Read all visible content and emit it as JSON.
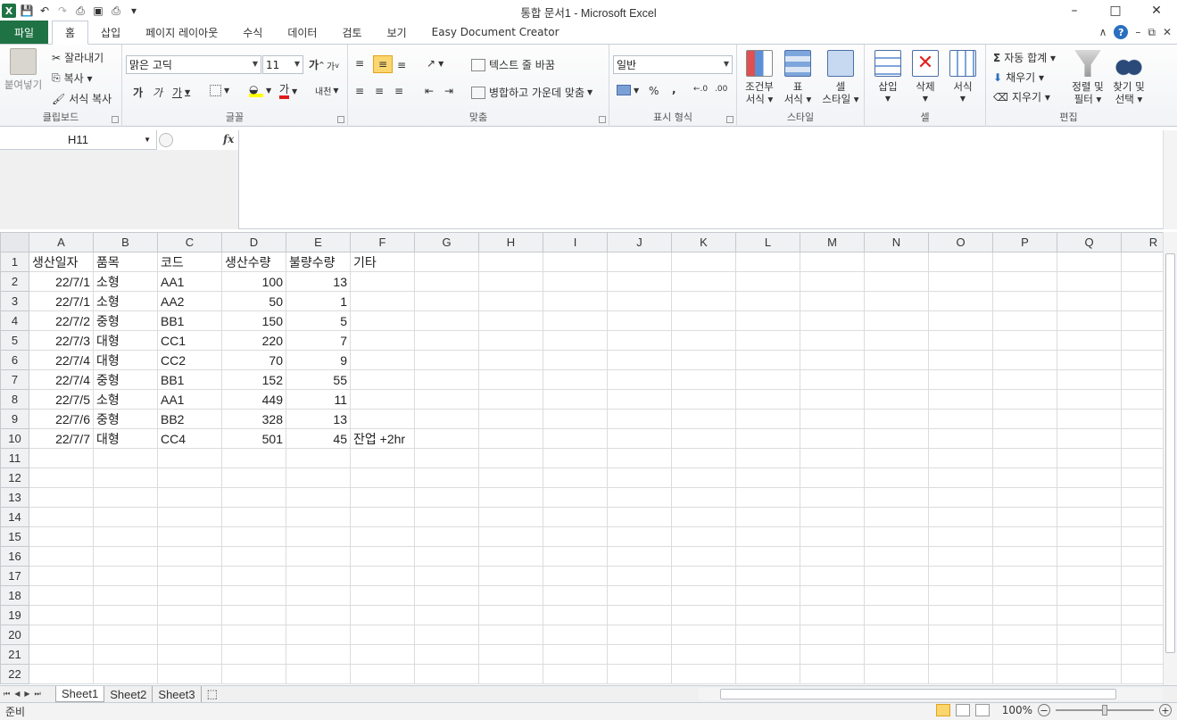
{
  "title": "통합 문서1  -  Microsoft Excel",
  "tabs": [
    "파일",
    "홈",
    "삽입",
    "페이지 레이아웃",
    "수식",
    "데이터",
    "검토",
    "보기",
    "Easy Document Creator"
  ],
  "ribbon": {
    "clipboard": {
      "label": "클립보드",
      "paste": "붙여넣기",
      "cut": "잘라내기",
      "copy": "복사 ▾",
      "format_painter": "서식 복사"
    },
    "font": {
      "label": "글꼴",
      "name": "맑은 고딕",
      "size": "11",
      "bold": "가",
      "italic": "가",
      "underline": "가",
      "grow": "가",
      "shrink": "가",
      "color_a": "가",
      "phonetic": "내천"
    },
    "alignment": {
      "label": "맞춤",
      "wrap": "텍스트 줄 바꿈",
      "merge": "병합하고 가운데 맞춤"
    },
    "number": {
      "label": "표시 형식",
      "format": "일반",
      "percent": "%",
      "comma": ","
    },
    "styles": {
      "label": "스타일",
      "conditional": "조건부\n서식 ▾",
      "table": "표\n서식 ▾",
      "cell": "셀\n스타일 ▾"
    },
    "cells": {
      "label": "셀",
      "insert": "삽입",
      "delete": "삭제",
      "format": "서식"
    },
    "editing": {
      "label": "편집",
      "autosum": "자동 합계 ▾",
      "fill": "채우기 ▾",
      "clear": "지우기 ▾",
      "sort": "정렬 및\n필터 ▾",
      "find": "찾기 및\n선택 ▾"
    }
  },
  "namebox": "H11",
  "fx": "fx",
  "columns": [
    "A",
    "B",
    "C",
    "D",
    "E",
    "F",
    "G",
    "H",
    "I",
    "J",
    "K",
    "L",
    "M",
    "N",
    "O",
    "P",
    "Q",
    "R"
  ],
  "sheet": {
    "header": [
      "생산일자",
      "품목",
      "코드",
      "생산수량",
      "불량수량",
      "기타"
    ],
    "rows": [
      [
        "22/7/1",
        "소형",
        "AA1",
        "100",
        "13",
        ""
      ],
      [
        "22/7/1",
        "소형",
        "AA2",
        "50",
        "1",
        ""
      ],
      [
        "22/7/2",
        "중형",
        "BB1",
        "150",
        "5",
        ""
      ],
      [
        "22/7/3",
        "대형",
        "CC1",
        "220",
        "7",
        ""
      ],
      [
        "22/7/4",
        "대형",
        "CC2",
        "70",
        "9",
        ""
      ],
      [
        "22/7/4",
        "중형",
        "BB1",
        "152",
        "55",
        ""
      ],
      [
        "22/7/5",
        "소형",
        "AA1",
        "449",
        "11",
        ""
      ],
      [
        "22/7/6",
        "중형",
        "BB2",
        "328",
        "13",
        ""
      ],
      [
        "22/7/7",
        "대형",
        "CC4",
        "501",
        "45",
        "잔업  +2hr"
      ]
    ],
    "row_count": 22
  },
  "sheet_tabs": [
    "Sheet1",
    "Sheet2",
    "Sheet3"
  ],
  "status": {
    "ready": "준비",
    "zoom": "100%"
  }
}
